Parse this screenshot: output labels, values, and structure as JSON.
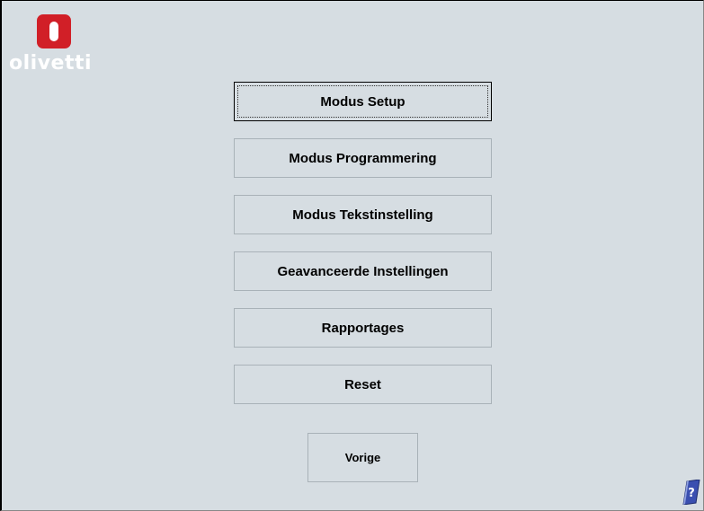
{
  "brand": {
    "name": "olivetti",
    "color": "#d11f27"
  },
  "menu": {
    "items": [
      {
        "label": "Modus Setup"
      },
      {
        "label": "Modus Programmering"
      },
      {
        "label": "Modus Tekstinstelling"
      },
      {
        "label": "Geavanceerde Instellingen"
      },
      {
        "label": "Rapportages"
      },
      {
        "label": "Reset"
      }
    ],
    "back_label": "Vorige"
  },
  "icons": {
    "help": "help-book-icon"
  }
}
